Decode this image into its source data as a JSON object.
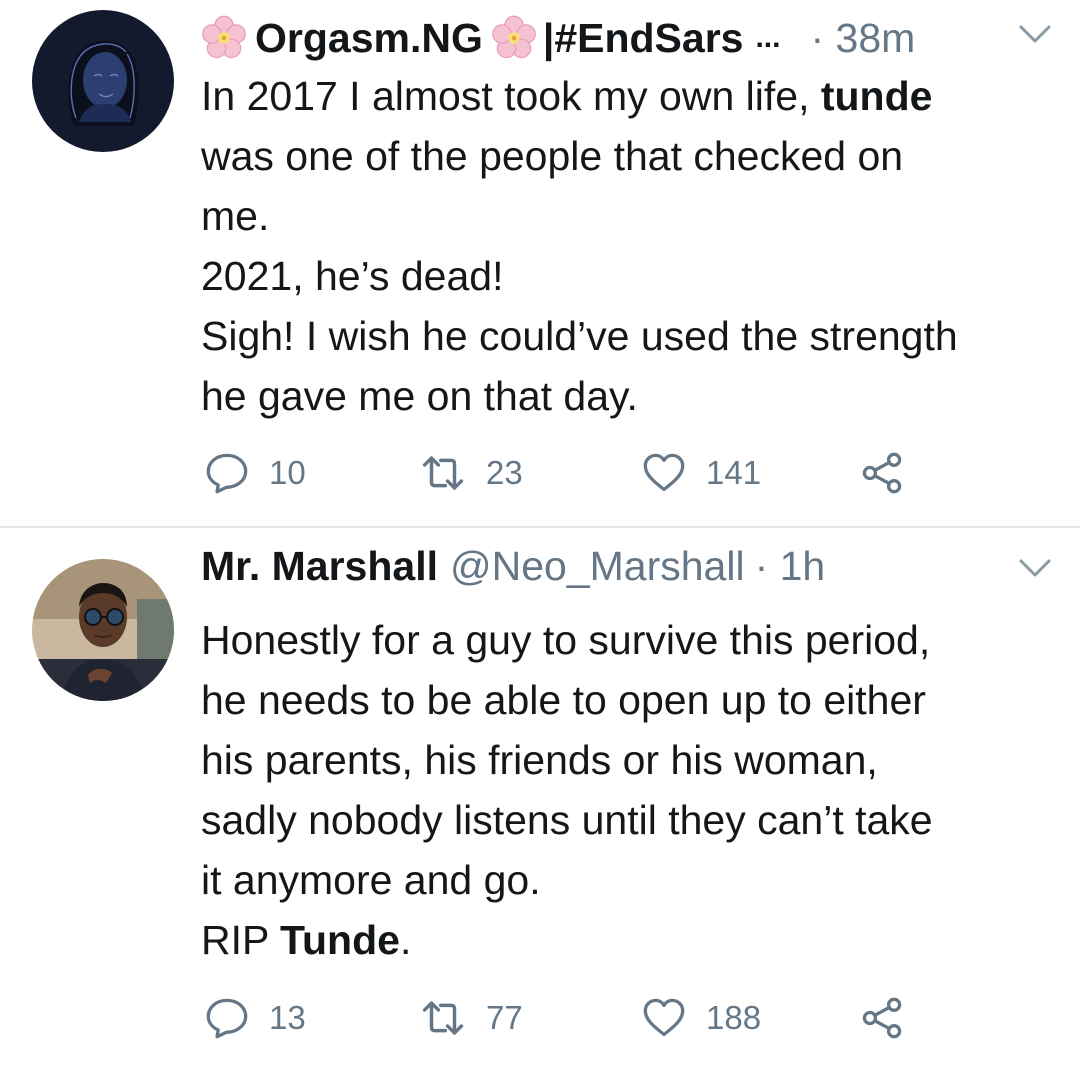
{
  "colors": {
    "text": "#14171a",
    "secondary": "#657786",
    "divider": "#e1e8ed",
    "icon": "#657786"
  },
  "tweets": [
    {
      "display_name_part1": "Orgasm.NG",
      "display_name_part2": "|#EndSars",
      "truncation": "...",
      "handle": "",
      "time": "· 38m",
      "emoji_icon": "cherry-blossom-icon",
      "lines": [
        {
          "pre": "In 2017 I almost took my own life, ",
          "bold": "tunde",
          "post": ""
        },
        {
          "pre": "was one of the people that checked on",
          "bold": "",
          "post": ""
        },
        {
          "pre": "me.",
          "bold": "",
          "post": ""
        },
        {
          "pre": "2021, he’s dead!",
          "bold": "",
          "post": ""
        },
        {
          "pre": "Sigh!  I wish he could’ve used the strength",
          "bold": "",
          "post": ""
        },
        {
          "pre": "he gave me on that day.",
          "bold": "",
          "post": ""
        }
      ],
      "replies": "10",
      "retweets": "23",
      "likes": "141"
    },
    {
      "display_name": "Mr. Marshall",
      "handle": "@Neo_Marshall",
      "time": "· 1h",
      "lines": [
        {
          "pre": "Honestly for a guy to survive this period,",
          "bold": "",
          "post": ""
        },
        {
          "pre": "he needs to be able to open up to either",
          "bold": "",
          "post": ""
        },
        {
          "pre": "his parents, his friends or his woman,",
          "bold": "",
          "post": ""
        },
        {
          "pre": "sadly nobody listens until they can’t take",
          "bold": "",
          "post": ""
        },
        {
          "pre": "it anymore and go.",
          "bold": "",
          "post": ""
        },
        {
          "pre": "RIP ",
          "bold": "Tunde",
          "post": "."
        }
      ],
      "replies": "13",
      "retweets": "77",
      "likes": "188"
    }
  ]
}
